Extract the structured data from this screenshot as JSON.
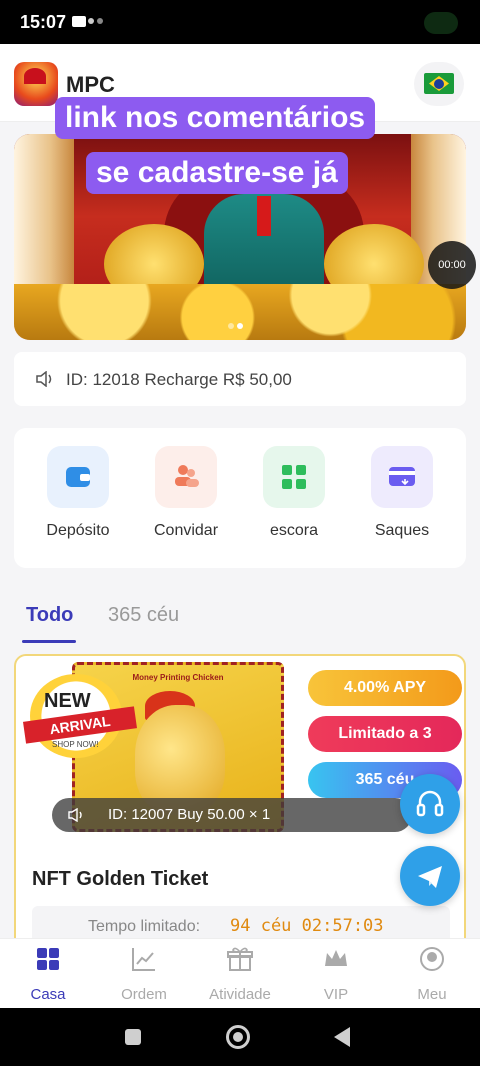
{
  "status_bar": {
    "time": "15:07"
  },
  "header": {
    "title": "MPC"
  },
  "banner": {
    "video_timer": "00:00"
  },
  "overlay": {
    "line1": "link nos comentários",
    "line2": "se cadastre-se já"
  },
  "notice": {
    "text": "ID: 12018 Recharge R$ 50,00"
  },
  "quick_actions": [
    {
      "label": "Depósito",
      "icon": "wallet-icon",
      "color": "#2f8ee6"
    },
    {
      "label": "Convidar",
      "icon": "users-icon",
      "color": "#ef7a5a"
    },
    {
      "label": "escora",
      "icon": "grid-icon",
      "color": "#2ebd5c"
    },
    {
      "label": "Saques",
      "icon": "card-icon",
      "color": "#6a5cf0"
    }
  ],
  "tabs": [
    {
      "label": "Todo",
      "active": true
    },
    {
      "label": "365 céu",
      "active": false
    }
  ],
  "product": {
    "ticket_title": "Money Printing Chicken",
    "badge_new": "NEW",
    "badge_arrival": "ARRIVAL",
    "badge_shop": "SHOP NOW!",
    "apy": "4.00% APY",
    "limit": "Limitado a 3",
    "duration": "365 céu",
    "name": "NFT Golden Ticket",
    "limit_label": "Tempo limitado:",
    "countdown": "94 céu 02:57:03"
  },
  "toast": {
    "text": "ID: 12007 Buy 50.00 × 1"
  },
  "bottom_nav": [
    {
      "label": "Casa",
      "icon": "home-grid-icon",
      "active": true
    },
    {
      "label": "Ordem",
      "icon": "chart-icon",
      "active": false
    },
    {
      "label": "Atividade",
      "icon": "gift-icon",
      "active": false
    },
    {
      "label": "VIP",
      "icon": "crown-icon",
      "active": false
    },
    {
      "label": "Meu",
      "icon": "profile-icon",
      "active": false
    }
  ],
  "colors": {
    "accent": "#3b3bb8",
    "overlay": "#8d5bf0",
    "fab": "#2fa0e8"
  }
}
